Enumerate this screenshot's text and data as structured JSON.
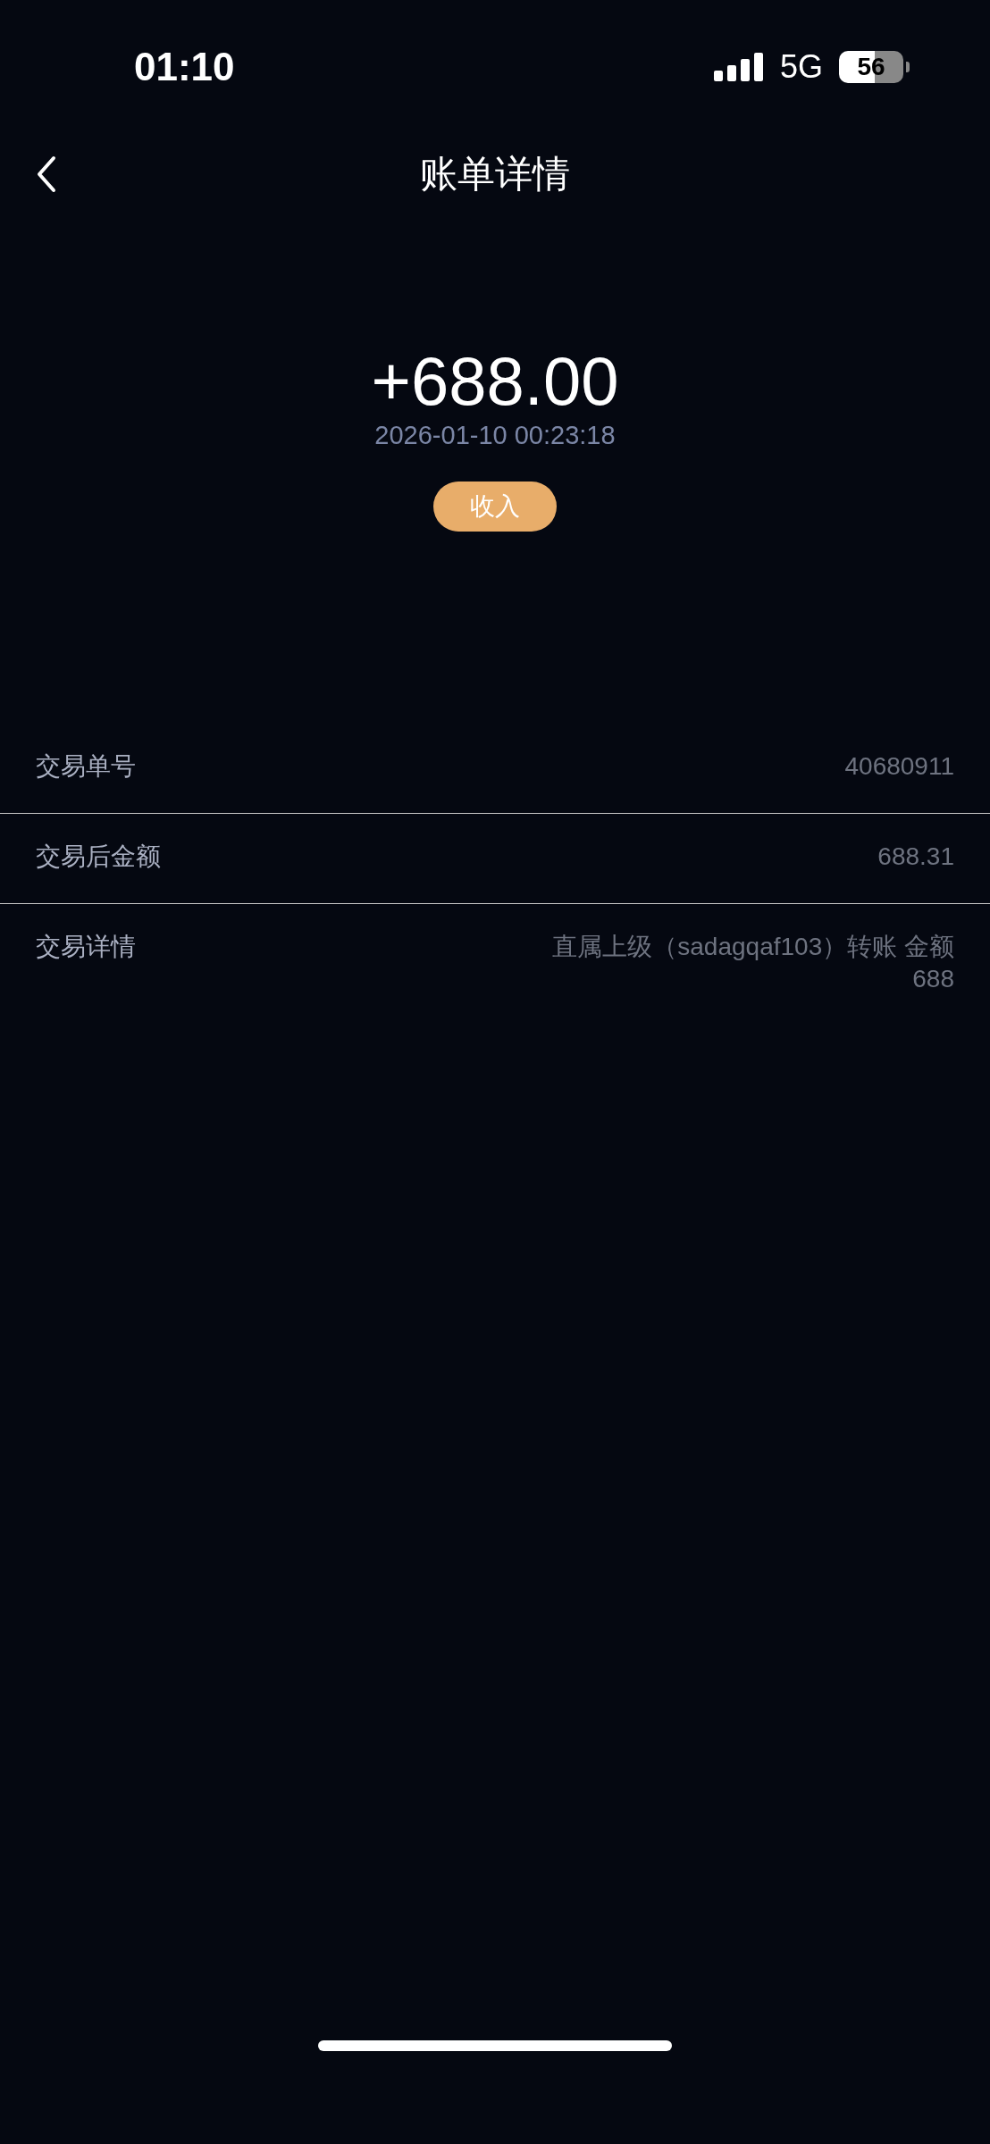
{
  "status_bar": {
    "time": "01:10",
    "network": "5G",
    "battery": "56"
  },
  "nav": {
    "title": "账单详情"
  },
  "summary": {
    "amount": "+688.00",
    "datetime": "2026-01-10 00:23:18",
    "badge": "收入"
  },
  "details": [
    {
      "label": "交易单号",
      "value": "40680911"
    },
    {
      "label": "交易后金额",
      "value": "688.31"
    },
    {
      "label": "交易详情",
      "value": "直属上级（sadagqaf103）转账 金额 688"
    }
  ]
}
